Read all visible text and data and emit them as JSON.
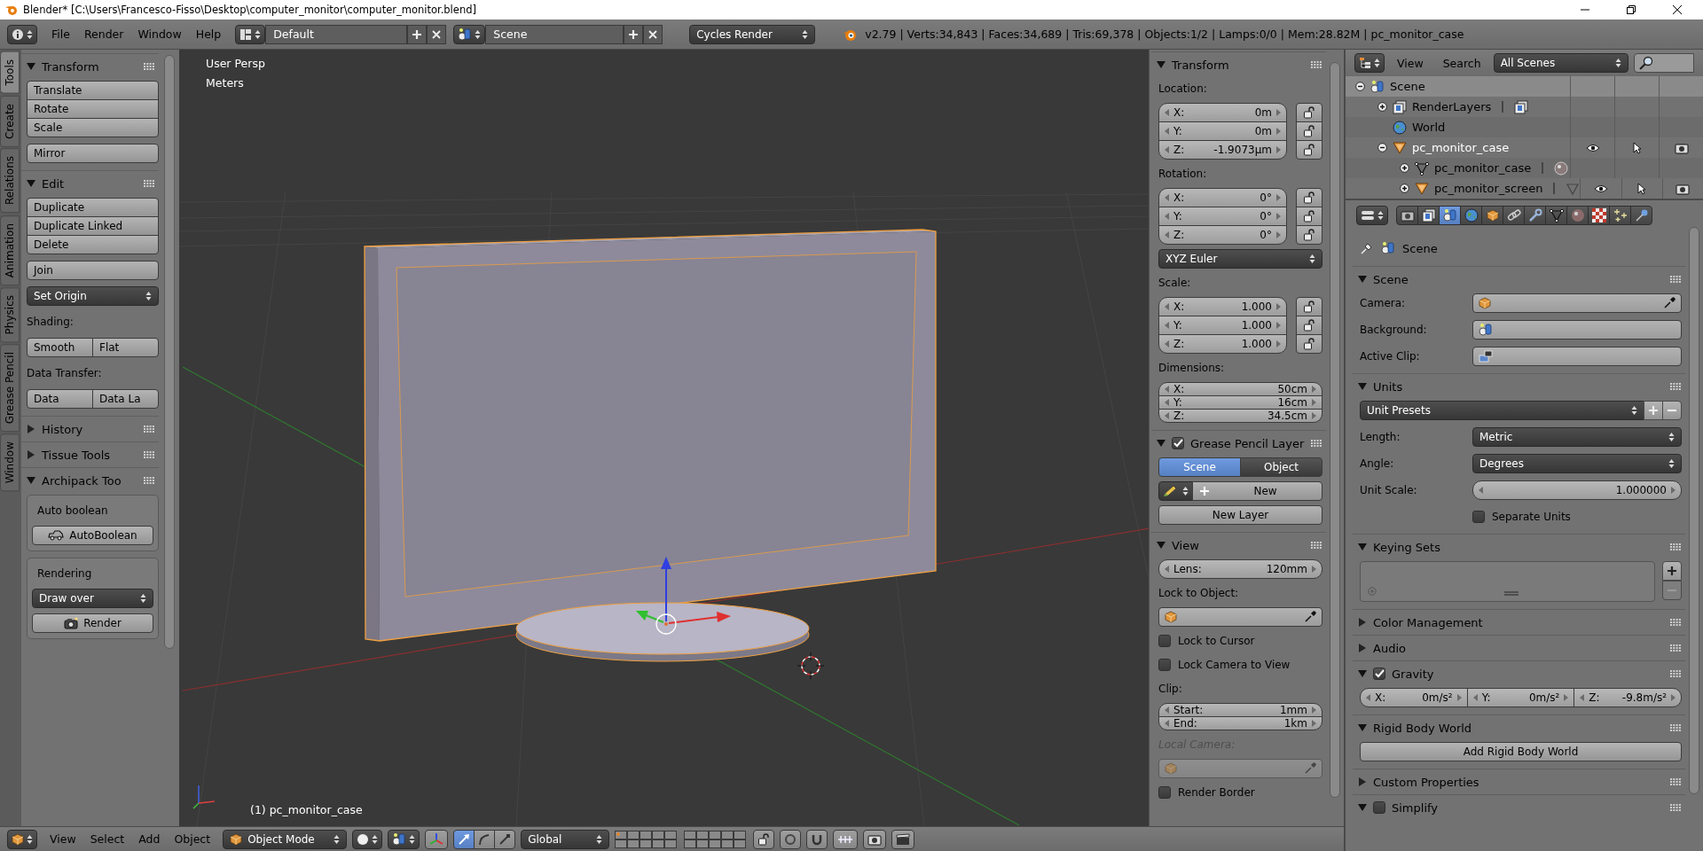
{
  "window": {
    "title": "Blender* [C:\\Users\\Francesco-Fisso\\Desktop\\computer_monitor\\computer_monitor.blend]"
  },
  "info_header": {
    "menus": [
      "File",
      "Render",
      "Window",
      "Help"
    ],
    "layout": "Default",
    "scene": "Scene",
    "engine": "Cycles Render",
    "stats": "v2.79 | Verts:34,843 | Faces:34,689 | Tris:69,378 | Objects:1/2 | Lamps:0/0 | Mem:28.82M | pc_monitor_case"
  },
  "tool_tabs": [
    {
      "label": "Tools",
      "selected": true
    },
    {
      "label": "Create",
      "selected": false
    },
    {
      "label": "Relations",
      "selected": false
    },
    {
      "label": "Animation",
      "selected": false
    },
    {
      "label": "Physics",
      "selected": false
    },
    {
      "label": "Grease Pencil",
      "selected": false
    },
    {
      "label": "Window",
      "selected": false
    }
  ],
  "tool_shelf": {
    "panels": [
      {
        "title": "Transform",
        "expanded": true,
        "rows": [
          {
            "kind": "stack",
            "buttons": [
              "Translate",
              "Rotate",
              "Scale"
            ]
          },
          {
            "kind": "stack",
            "buttons": [
              "Mirror"
            ]
          }
        ]
      },
      {
        "title": "Edit",
        "expanded": true,
        "rows": [
          {
            "kind": "stack",
            "buttons": [
              "Duplicate",
              "Duplicate Linked",
              "Delete"
            ]
          },
          {
            "kind": "stack",
            "buttons": [
              "Join"
            ]
          },
          {
            "kind": "dropdown",
            "value": "Set Origin"
          },
          {
            "kind": "label",
            "text": "Shading:"
          },
          {
            "kind": "row",
            "buttons": [
              "Smooth",
              "Flat"
            ]
          },
          {
            "kind": "label",
            "text": "Data Transfer:"
          },
          {
            "kind": "row",
            "buttons": [
              "Data",
              "Data La"
            ]
          }
        ]
      },
      {
        "title": "History",
        "expanded": false
      },
      {
        "title": "Tissue Tools",
        "expanded": false
      },
      {
        "title": "Archipack Too",
        "expanded": true,
        "rows": [
          {
            "kind": "box",
            "rows": [
              {
                "kind": "label",
                "text": "Auto boolean"
              },
              {
                "kind": "icon-button",
                "label": "AutoBoolean"
              }
            ]
          },
          {
            "kind": "box",
            "rows": [
              {
                "kind": "label",
                "text": "Rendering"
              },
              {
                "kind": "dropdown",
                "value": "Draw over"
              },
              {
                "kind": "icon-button",
                "label": "Render"
              }
            ]
          }
        ]
      }
    ]
  },
  "viewport": {
    "view_name": "User Persp",
    "units": "Meters",
    "object_label": "(1) pc_monitor_case"
  },
  "n_panel": {
    "panels": [
      {
        "title": "Transform",
        "expanded": true,
        "rows": [
          {
            "kind": "label",
            "text": "Location:"
          },
          {
            "kind": "vector",
            "lockable": true,
            "fields": [
              {
                "axis": "X:",
                "value": "0m"
              },
              {
                "axis": "Y:",
                "value": "0m"
              },
              {
                "axis": "Z:",
                "value": "-1.9073µm"
              }
            ]
          },
          {
            "kind": "label",
            "text": "Rotation:"
          },
          {
            "kind": "vector",
            "lockable": true,
            "fields": [
              {
                "axis": "X:",
                "value": "0°"
              },
              {
                "axis": "Y:",
                "value": "0°"
              },
              {
                "axis": "Z:",
                "value": "0°"
              }
            ]
          },
          {
            "kind": "dropdown",
            "value": "XYZ Euler"
          },
          {
            "kind": "label",
            "text": "Scale:"
          },
          {
            "kind": "vector",
            "lockable": true,
            "fields": [
              {
                "axis": "X:",
                "value": "1.000"
              },
              {
                "axis": "Y:",
                "value": "1.000"
              },
              {
                "axis": "Z:",
                "value": "1.000"
              }
            ]
          },
          {
            "kind": "label",
            "text": "Dimensions:"
          },
          {
            "kind": "vector",
            "lockable": false,
            "fields": [
              {
                "axis": "X:",
                "value": "50cm"
              },
              {
                "axis": "Y:",
                "value": "16cm"
              },
              {
                "axis": "Z:",
                "value": "34.5cm"
              }
            ]
          }
        ]
      },
      {
        "title": "Grease Pencil Layer",
        "expanded": true,
        "checked": true,
        "rows": [
          {
            "kind": "toggle",
            "options": [
              {
                "label": "Scene",
                "selected": true
              },
              {
                "label": "Object",
                "selected": false
              }
            ]
          },
          {
            "kind": "new",
            "label": "New"
          },
          {
            "kind": "button",
            "label": "New Layer"
          }
        ]
      },
      {
        "title": "View",
        "expanded": true,
        "rows": [
          {
            "kind": "number",
            "label": "Lens:",
            "value": "120mm"
          },
          {
            "kind": "label",
            "text": "Lock to Object:",
            "disabled": false
          },
          {
            "kind": "id",
            "disabled": false
          },
          {
            "kind": "check",
            "label": "Lock to Cursor",
            "checked": false
          },
          {
            "kind": "check",
            "label": "Lock Camera to View",
            "checked": false
          },
          {
            "kind": "label",
            "text": "Clip:",
            "disabled": false
          },
          {
            "kind": "vector",
            "lockable": false,
            "fields": [
              {
                "axis": "Start:",
                "value": "1mm"
              },
              {
                "axis": "End:",
                "value": "1km"
              }
            ]
          },
          {
            "kind": "label",
            "text": "Local Camera:",
            "disabled": true
          },
          {
            "kind": "id",
            "disabled": true
          },
          {
            "kind": "check",
            "label": "Render Border",
            "checked": false
          }
        ]
      }
    ]
  },
  "outliner": {
    "menus": [
      "View",
      "Search"
    ],
    "filter": "All Scenes",
    "tree": [
      {
        "kind": "scene",
        "name": "Scene",
        "selected": true,
        "active": false,
        "expanded": true,
        "children": [
          {
            "kind": "render-layers",
            "name": "RenderLayers",
            "selected": false,
            "active": false,
            "expanded": false
          },
          {
            "kind": "world",
            "name": "World",
            "selected": false,
            "active": false
          },
          {
            "kind": "object",
            "name": "pc_monitor_case",
            "selected": false,
            "active": true,
            "expanded": true,
            "children": [
              {
                "kind": "mesh",
                "name": "pc_monitor_case",
                "selected": false,
                "active": false,
                "expanded": false
              },
              {
                "kind": "object",
                "name": "pc_monitor_screen",
                "selected": false,
                "active": false,
                "expanded": false
              }
            ]
          }
        ]
      }
    ]
  },
  "properties": {
    "context_tabs": [
      {
        "selected": false
      },
      {
        "selected": false
      },
      {
        "selected": true
      },
      {
        "selected": false
      },
      {
        "selected": false
      },
      {
        "selected": false
      },
      {
        "selected": false
      },
      {
        "selected": false
      },
      {
        "selected": false
      },
      {
        "selected": false
      },
      {
        "selected": false
      },
      {
        "selected": false
      }
    ],
    "breadcrumb": "Scene",
    "panels": [
      {
        "title": "Scene",
        "expanded": true,
        "rows": [
          {
            "kind": "prop",
            "label": "Camera:"
          },
          {
            "kind": "prop",
            "label": "Background:"
          },
          {
            "kind": "prop",
            "label": "Active Clip:"
          }
        ]
      },
      {
        "title": "Units",
        "expanded": true,
        "rows": [
          {
            "kind": "preset",
            "value": "Unit Presets"
          },
          {
            "kind": "prop-select",
            "label": "Length:",
            "value": "Metric"
          },
          {
            "kind": "prop-select",
            "label": "Angle:",
            "value": "Degrees"
          },
          {
            "kind": "prop-number",
            "label": "Unit Scale:",
            "value": "1.000000"
          },
          {
            "kind": "prop-check",
            "label": "Separate Units",
            "checked": false
          }
        ]
      },
      {
        "title": "Keying Sets",
        "expanded": true,
        "rows": [
          {
            "kind": "list"
          }
        ]
      },
      {
        "title": "Color Management",
        "expanded": false
      },
      {
        "title": "Audio",
        "expanded": false
      },
      {
        "title": "Gravity",
        "expanded": true,
        "checked": true,
        "rows": [
          {
            "kind": "numrow",
            "fields": [
              {
                "axis": "X:",
                "value": "0m/s²"
              },
              {
                "axis": "Y:",
                "value": "0m/s²"
              },
              {
                "axis": "Z:",
                "value": "-9.8m/s²"
              }
            ]
          }
        ]
      },
      {
        "title": "Rigid Body World",
        "expanded": true,
        "rows": [
          {
            "kind": "button",
            "label": "Add Rigid Body World"
          }
        ]
      },
      {
        "title": "Custom Properties",
        "expanded": false
      },
      {
        "title": "Simplify",
        "expanded": true,
        "checked": false
      }
    ]
  },
  "view3d_header": {
    "menus": [
      "View",
      "Select",
      "Add",
      "Object"
    ],
    "mode": "Object Mode",
    "orientation": "Global",
    "manipulators": [
      {
        "selected": true
      },
      {
        "selected": false
      },
      {
        "selected": false
      }
    ]
  }
}
